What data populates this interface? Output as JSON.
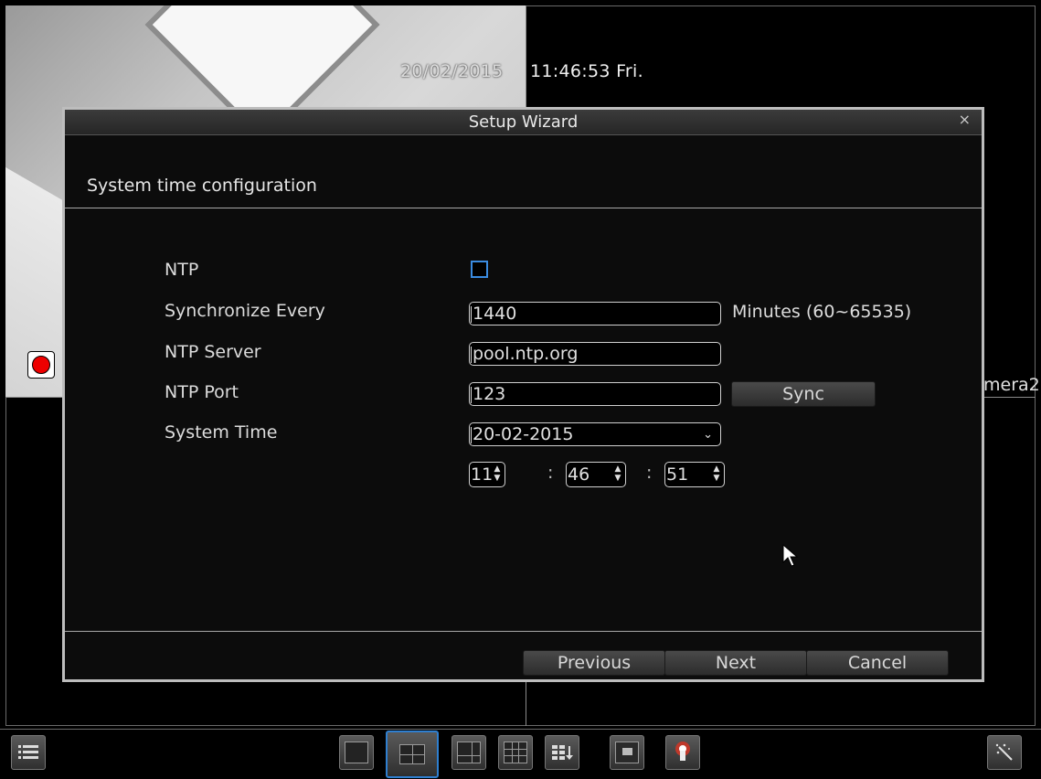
{
  "osd": {
    "date": "20/02/2015",
    "time": "11:46:53 Fri.",
    "camera2_label": "mera2"
  },
  "dialog": {
    "title": "Setup Wizard",
    "close_glyph": "×",
    "heading": "System time configuration",
    "fields": {
      "ntp_label": "NTP",
      "ntp_checked": false,
      "sync_label": "Synchronize Every",
      "sync_value": "1440",
      "sync_unit": "Minutes (60~65535)",
      "server_label": "NTP Server",
      "server_value": "pool.ntp.org",
      "port_label": "NTP Port",
      "port_value": "123",
      "sync_button": "Sync",
      "systime_label": "System Time",
      "date_value": "20-02-2015",
      "hour": "11",
      "minute": "46",
      "second": "51",
      "time_sep": ":"
    },
    "buttons": {
      "previous": "Previous",
      "next": "Next",
      "cancel": "Cancel"
    }
  },
  "taskbar": {
    "items": [
      "menu-icon",
      "layout-1-icon",
      "layout-4-icon",
      "layout-6-icon",
      "layout-9-icon",
      "sequence-icon",
      "pip-icon",
      "ptz-icon",
      "wizard-icon"
    ],
    "active_item": "layout-4-icon"
  },
  "colors": {
    "accent": "#2f7fcf",
    "checkbox_border": "#3a8be0",
    "record": "#e00000"
  }
}
